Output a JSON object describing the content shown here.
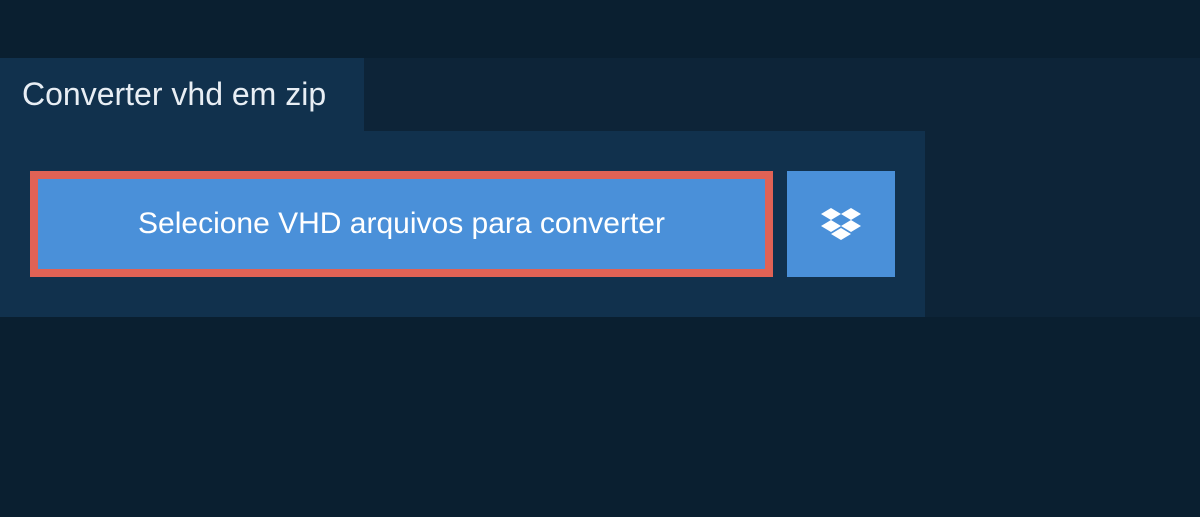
{
  "header": {
    "tab_label": "Converter vhd em zip"
  },
  "main": {
    "select_button_label": "Selecione VHD arquivos para converter"
  },
  "colors": {
    "background_dark": "#0a1f30",
    "background_panel": "#11314d",
    "button_primary": "#4a90d9",
    "button_border_highlight": "#e06255",
    "text_light": "#ffffff"
  }
}
